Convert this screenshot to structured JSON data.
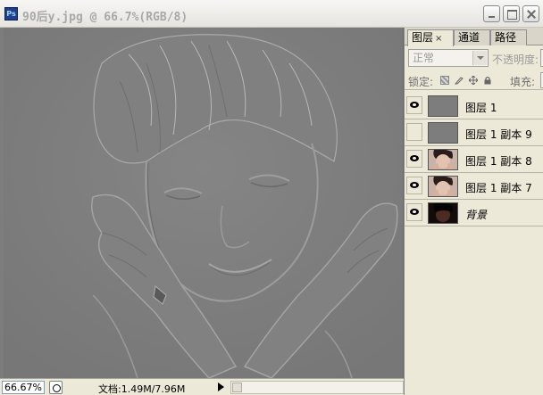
{
  "window": {
    "title": "90后y.jpg @ 66.7%(RGB/8)",
    "app_icon_text": "Ps"
  },
  "statusbar": {
    "zoom": "66.67%",
    "doc_size": "文档:1.49M/7.96M"
  },
  "layers_panel": {
    "tabs": [
      {
        "label": "图层",
        "active": true
      },
      {
        "label": "通道",
        "active": false
      },
      {
        "label": "路径",
        "active": false
      }
    ],
    "tab_close_glyph": "×",
    "blend_mode": "正常",
    "opacity_label": "不透明度:",
    "lock_label": "锁定:",
    "fill_label": "填充:",
    "layers": [
      {
        "name": "图层 1",
        "visible": true,
        "thumb": "gray"
      },
      {
        "name": "图层 1 副本 9",
        "visible": false,
        "thumb": "gray"
      },
      {
        "name": "图层 1 副本 8",
        "visible": true,
        "thumb": "photo"
      },
      {
        "name": "图层 1 副本 7",
        "visible": true,
        "thumb": "photo"
      },
      {
        "name": "背景",
        "visible": true,
        "thumb": "dark-photo"
      }
    ]
  },
  "icons": {
    "app": "photoshop-icon",
    "eye": "eye-icon",
    "lock": "lock-icon",
    "move": "move-icon",
    "brush": "brush-icon"
  }
}
